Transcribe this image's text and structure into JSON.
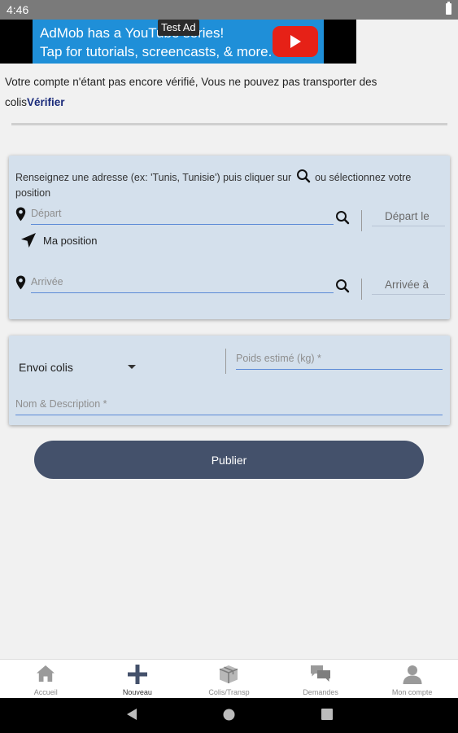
{
  "status_bar": {
    "time": "4:46"
  },
  "ad": {
    "line1": "AdMob has a YouTube series!",
    "line2": "Tap for tutorials, screencasts, & more.",
    "badge": "Test Ad",
    "brand_color": "#1f8fd8"
  },
  "verification": {
    "message": "Votre compte n'étant pas encore vérifié, Vous ne pouvez pas transporter des colis",
    "link_label": "Vérifier"
  },
  "address_card": {
    "hint_before_icon": "Renseignez une adresse (ex: 'Tunis, Tunisie') puis cliquer sur",
    "hint_after_icon": "ou sélectionnez votre position",
    "departure_placeholder": "Départ",
    "departure_time_label": "Départ le",
    "my_position_label": "Ma position",
    "arrival_placeholder": "Arrivée",
    "arrival_time_label": "Arrivée à"
  },
  "parcel_card": {
    "type_selected": "Envoi colis",
    "weight_placeholder": "Poids estimé (kg) *",
    "description_placeholder": "Nom & Description *"
  },
  "publish_label": "Publier",
  "bottom_nav": {
    "items": [
      {
        "label": "Accueil",
        "icon": "home-icon"
      },
      {
        "label": "Nouveau",
        "icon": "plus-icon",
        "active": true
      },
      {
        "label": "Colis/Transp",
        "icon": "package-icon"
      },
      {
        "label": "Demandes",
        "icon": "chat-icon"
      },
      {
        "label": "Mon compte",
        "icon": "account-icon"
      }
    ]
  },
  "colors": {
    "card_background": "#d4e0ec",
    "primary_button": "#44516b",
    "field_underline": "#5b8ad6",
    "link": "#1a2a7a"
  }
}
